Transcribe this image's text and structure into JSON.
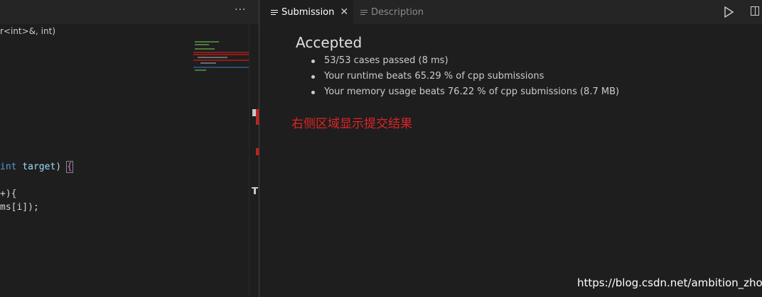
{
  "left_editor": {
    "more_label": "···",
    "breadcrumb": "r<int>&, int)",
    "code": {
      "line1_kw": "int",
      "line1_var": "target",
      "line1_close": ")",
      "line1_brace": "{",
      "line2": "+){",
      "line3": "ms[i]);"
    }
  },
  "tabs": {
    "submission_label": "Submission",
    "close_label": "✕",
    "description_label": "Description"
  },
  "result": {
    "status": "Accepted",
    "items": [
      "53/53 cases passed (8 ms)",
      "Your runtime beats 65.29 % of cpp submissions",
      "Your memory usage beats 76.22 % of cpp submissions (8.7 MB)"
    ]
  },
  "annotation": "右侧区域显示提交结果",
  "watermark": "https://blog.csdn.net/ambition_zhou",
  "colors": {
    "background": "#1e1e1e",
    "accent_red": "#e02424"
  }
}
